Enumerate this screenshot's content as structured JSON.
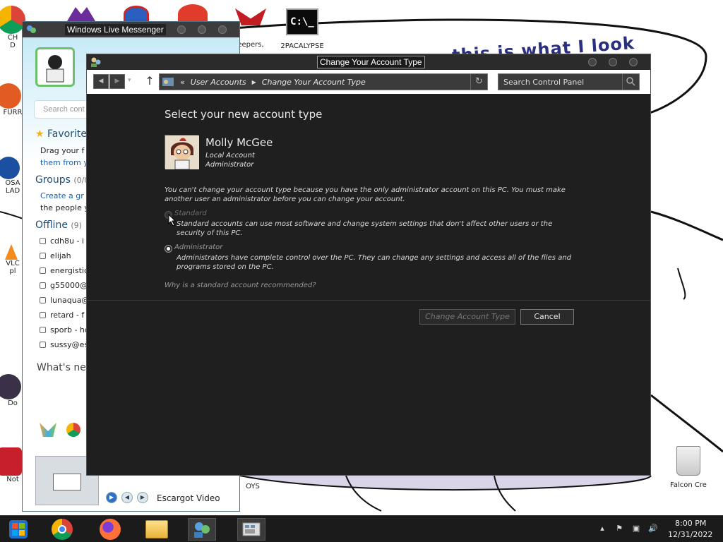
{
  "desktop": {
    "wallpaper_text": "this is what I look",
    "icons": [
      {
        "label": "CH"
      },
      {
        "label": "D"
      },
      {
        "label": "FURR"
      },
      {
        "label": "OSA"
      },
      {
        "label": "LAD"
      },
      {
        "label": "VLC"
      },
      {
        "label": "pl"
      },
      {
        "label": "Do"
      },
      {
        "label": "Not"
      },
      {
        "label": "eepers,"
      },
      {
        "label": "2PACALYPSE"
      },
      {
        "label": "OYS"
      },
      {
        "label": "Falcon Cre"
      }
    ],
    "cmd_icon_text": "C:\\_"
  },
  "messenger": {
    "title": "Windows Live Messenger",
    "search_placeholder": "Search cont",
    "favorites_heading": "Favorite",
    "favorites_text1": "Drag your f",
    "favorites_text2": "them from y",
    "groups_heading": "Groups",
    "groups_count": "(0/0",
    "groups_link": "Create a gr",
    "groups_text": "the people y",
    "offline_heading": "Offline",
    "offline_count": "(9)",
    "contacts": [
      "cdh8u - i a",
      "elijah",
      "energistic",
      "g55000@e",
      "lunaqua@e",
      "retard - f",
      "sporb - ho",
      "sussy@es"
    ],
    "whats_new": "What's ne",
    "video_label": "Escargot Video"
  },
  "dialog": {
    "title": "Change Your Account Type",
    "breadcrumb_prefix": "«",
    "breadcrumb": [
      "User Accounts",
      "Change Your Account Type"
    ],
    "search_placeholder": "Search Control Panel",
    "heading": "Select your new account type",
    "user": {
      "name": "Molly McGee",
      "account_kind": "Local Account",
      "role": "Administrator"
    },
    "notice": "You can't change your account type because you have the only administrator account on this PC. You must make another user an administrator before you can change your account.",
    "options": [
      {
        "label": "Standard",
        "description": "Standard accounts can use most software and change system settings that don't affect other users or the security of this PC.",
        "selected": false,
        "enabled": false
      },
      {
        "label": "Administrator",
        "description": "Administrators have complete control over the PC. They can change any settings and access all of the files and programs stored on the PC.",
        "selected": true,
        "enabled": true
      }
    ],
    "why_link": "Why is a standard account recommended?",
    "change_button": "Change Account Type",
    "cancel_button": "Cancel"
  },
  "taskbar": {
    "time": "8:00 PM",
    "date": "12/31/2022"
  }
}
